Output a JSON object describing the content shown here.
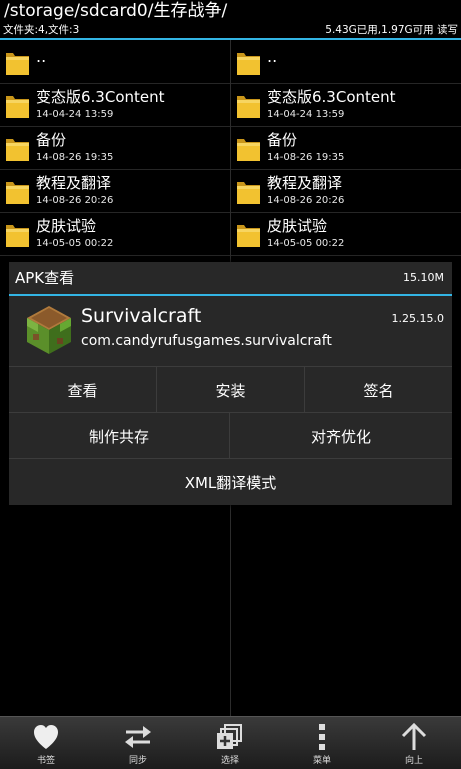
{
  "header": {
    "path": "/storage/sdcard0/生存战争/",
    "counts": "文件夹:4,文件:3",
    "storage": "5.43G已用,1.97G可用 读写"
  },
  "files": [
    {
      "name": "..",
      "date": ""
    },
    {
      "name": "变态版6.3Content",
      "date": "14-04-24 13:59"
    },
    {
      "name": "备份",
      "date": "14-08-26 19:35"
    },
    {
      "name": "教程及翻译",
      "date": "14-08-26 20:26"
    },
    {
      "name": "皮肤试验",
      "date": "14-05-05 00:22"
    }
  ],
  "dialog": {
    "title": "APK查看",
    "size": "15.10M",
    "app_name": "Survivalcraft",
    "package": "com.candyrufusgames.survivalcraft",
    "version": "1.25.15.0",
    "buttons_row1": [
      "查看",
      "安装",
      "签名"
    ],
    "buttons_row2": [
      "制作共存",
      "对齐优化"
    ],
    "buttons_row3": [
      "XML翻译模式"
    ]
  },
  "bottom_bar": [
    {
      "icon": "heart-icon",
      "label": "书签"
    },
    {
      "icon": "sync-arrows-icon",
      "label": "同步"
    },
    {
      "icon": "multi-select-icon",
      "label": "选择"
    },
    {
      "icon": "more-vertical-icon",
      "label": "菜单"
    },
    {
      "icon": "arrow-up-icon",
      "label": "向上"
    }
  ],
  "colors": {
    "accent": "#33b5e5",
    "folder": "#f2c230",
    "background": "#000000",
    "dialog": "#282828"
  }
}
